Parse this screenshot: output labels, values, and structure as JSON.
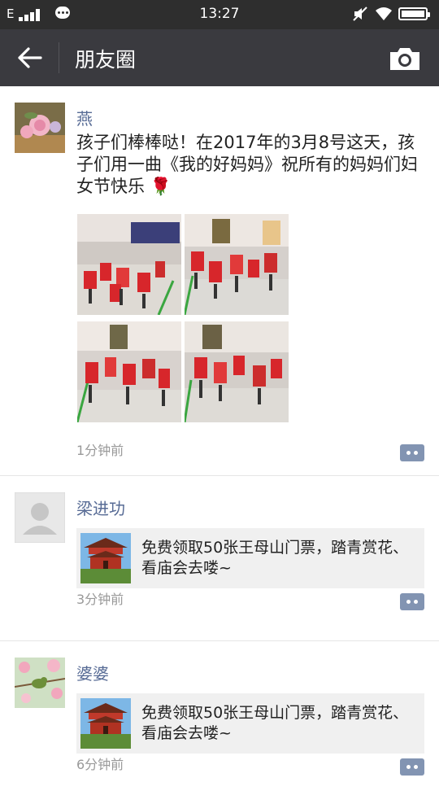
{
  "status_bar": {
    "network": "E",
    "time": "13:27"
  },
  "nav": {
    "title": "朋友圈",
    "back_icon": "arrow-left-icon",
    "camera_icon": "camera-icon"
  },
  "colors": {
    "nav_bg": "#3a3a3f",
    "name_blue": "#576b95",
    "comment_button": "#8294b2",
    "card_bg": "#f0f0f0"
  },
  "posts": [
    {
      "name": "燕",
      "text": "孩子们棒棒哒！在2017年的3月8号这天，孩子们用一曲《我的好妈妈》祝所有的妈妈们妇女节快乐",
      "emoji": "🌹",
      "time": "1分钟前"
    },
    {
      "name": "梁进功",
      "link_text": "免费领取50张王母山门票，踏青赏花、看庙会去喽~",
      "time": "3分钟前"
    },
    {
      "name": "婆婆",
      "link_text": "免费领取50张王母山门票，踏青赏花、看庙会去喽~",
      "time": "6分钟前"
    }
  ]
}
